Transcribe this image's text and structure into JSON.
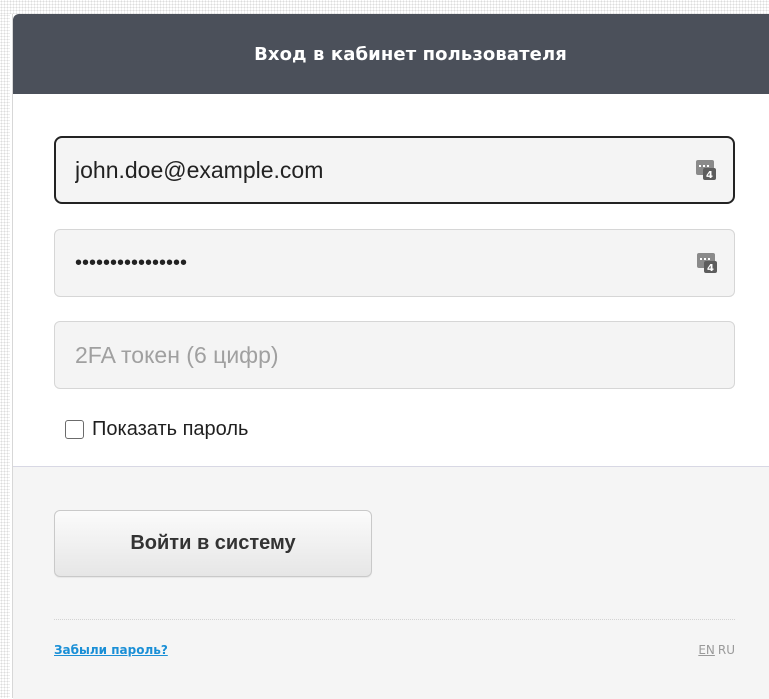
{
  "header": {
    "title": "Вход в кабинет пользователя"
  },
  "form": {
    "email": {
      "value": "john.doe@example.com",
      "icon": "password-manager-icon"
    },
    "password": {
      "value": "••••••••••••••••",
      "icon": "password-manager-icon"
    },
    "token": {
      "placeholder": "2FA токен (6 цифр)"
    },
    "show_password_label": "Показать пароль",
    "show_password_checked": false
  },
  "footer": {
    "login_button": "Войти в систему",
    "forgot_link": "Забыли пароль?",
    "lang_en": "EN",
    "lang_ru": "RU"
  },
  "colors": {
    "header_bg": "#4b505a",
    "link": "#1a8fd6",
    "focus_border": "#232323"
  }
}
